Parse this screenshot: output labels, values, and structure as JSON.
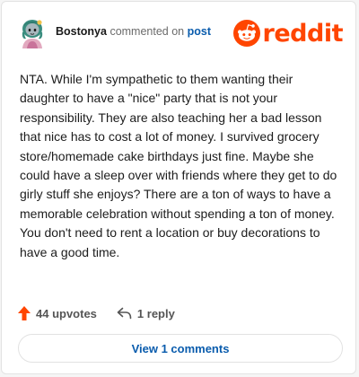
{
  "comment": {
    "author": "Bostonya",
    "action_text": "commented on",
    "target_link": "post",
    "body": "NTA. While I'm sympathetic to them wanting their daughter to have a \"nice\" party that is not your responsibility. They are also teaching her a bad lesson that nice has to cost a lot of money. I survived grocery store/homemade cake birthdays just fine. Maybe she could have a sleep over with friends where they get to do girly stuff she enjoys? There are a ton of ways to have a memorable celebration without spending a ton of money. You don't need to rent a location or buy decorations to have a good time."
  },
  "brand": {
    "name": "reddit",
    "color": "#ff4500"
  },
  "actions": {
    "upvotes_label": "44 upvotes",
    "reply_label": "1 reply"
  },
  "footer": {
    "view_comments_label": "View 1 comments"
  },
  "icons": {
    "upvote": "upvote-arrow-icon",
    "reply": "reply-arrow-icon",
    "avatar": "snoo-avatar",
    "logo": "reddit-snoo-icon"
  },
  "colors": {
    "accent_link": "#0a5cad",
    "upvote": "#ff4500"
  }
}
